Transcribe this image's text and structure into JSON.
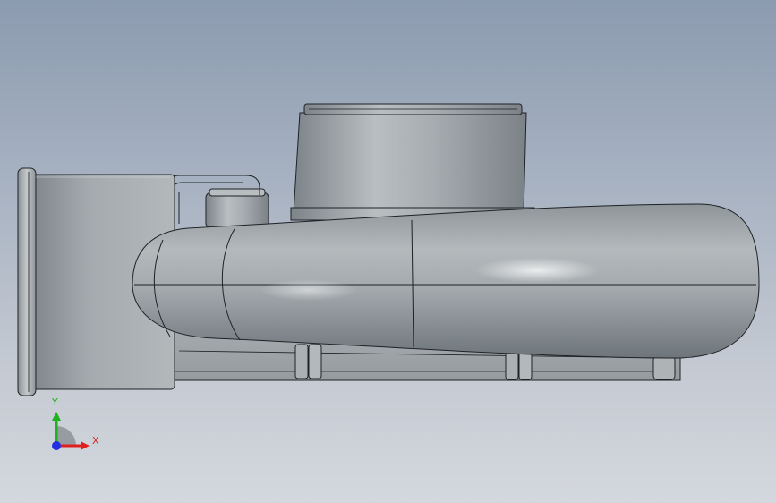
{
  "viewport": {
    "background_top": "#8c9bb0",
    "background_bottom": "#d4d8de",
    "model_color": "#9aa1a5",
    "edge_color": "#1e2225"
  },
  "triad": {
    "x_label": "X",
    "y_label": "Y",
    "x_color": "#e02020",
    "y_color": "#20b020",
    "z_color": "#2030e0"
  }
}
